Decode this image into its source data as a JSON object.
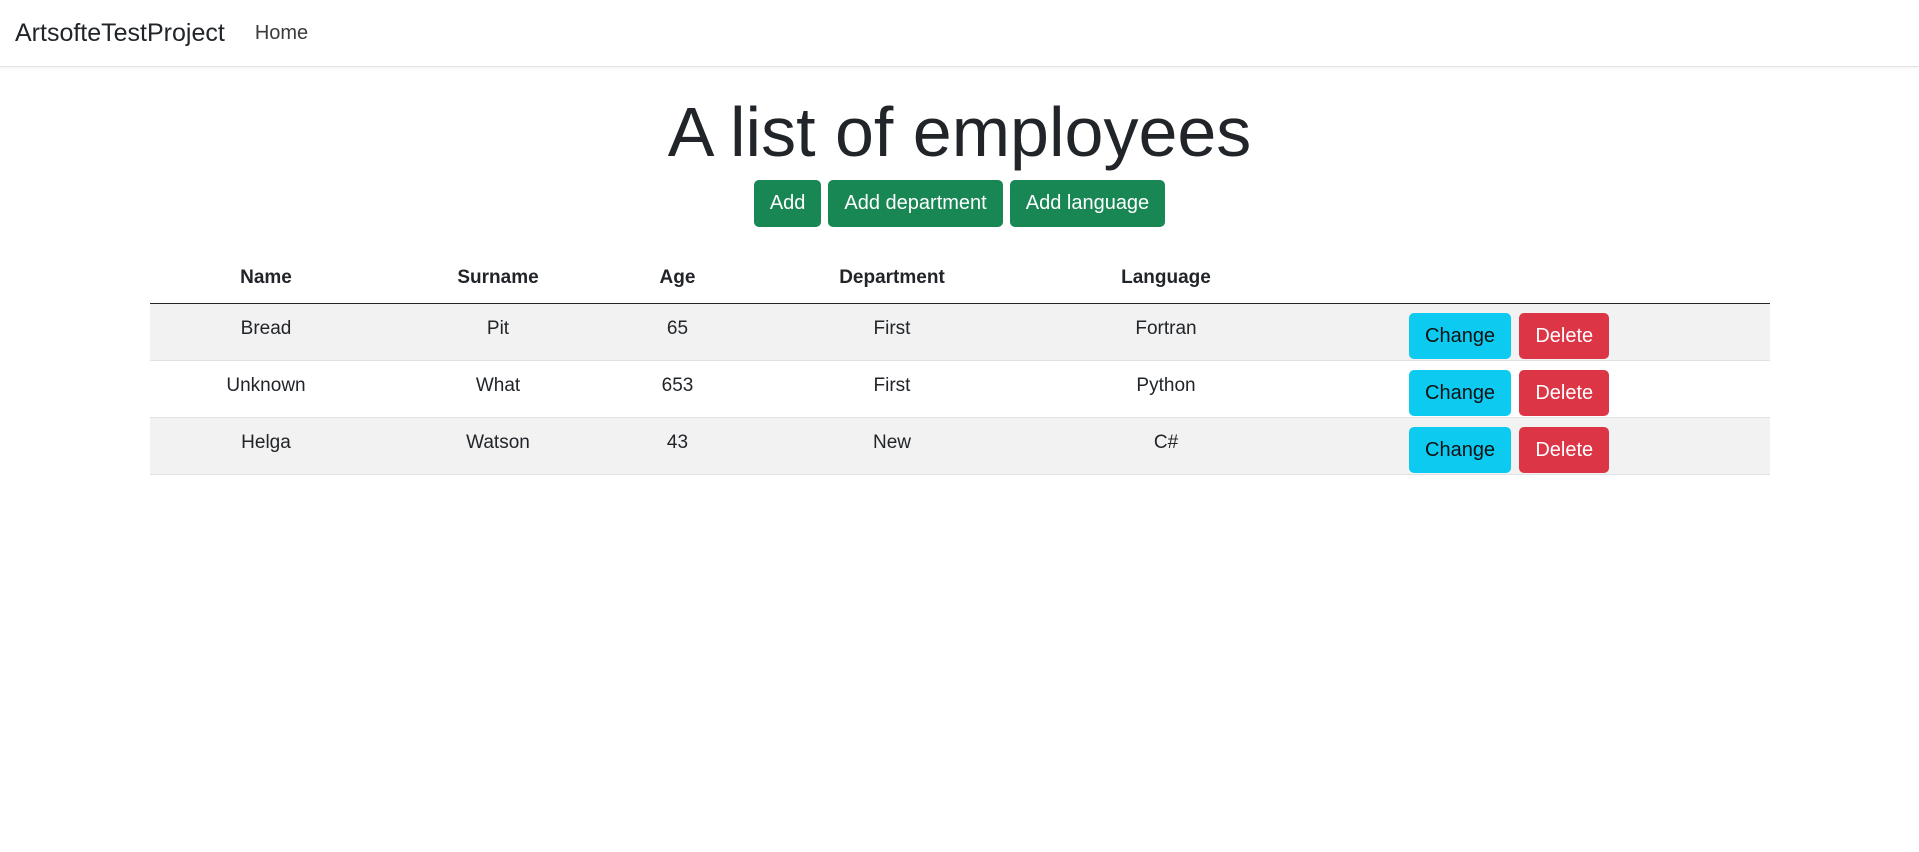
{
  "navbar": {
    "brand": "ArtsofteTestProject",
    "home_link": "Home"
  },
  "page": {
    "title": "A list of employees"
  },
  "toolbar": {
    "add_label": "Add",
    "add_department_label": "Add department",
    "add_language_label": "Add language"
  },
  "table": {
    "headers": [
      "Name",
      "Surname",
      "Age",
      "Department",
      "Language"
    ],
    "rows": [
      {
        "name": "Bread",
        "surname": "Pit",
        "age": "65",
        "department": "First",
        "language": "Fortran"
      },
      {
        "name": "Unknown",
        "surname": "What",
        "age": "653",
        "department": "First",
        "language": "Python"
      },
      {
        "name": "Helga",
        "surname": "Watson",
        "age": "43",
        "department": "New",
        "language": "C#"
      }
    ],
    "change_label": "Change",
    "delete_label": "Delete"
  },
  "colors": {
    "success": "#198754",
    "info": "#0dcaf0",
    "danger": "#dc3545"
  }
}
